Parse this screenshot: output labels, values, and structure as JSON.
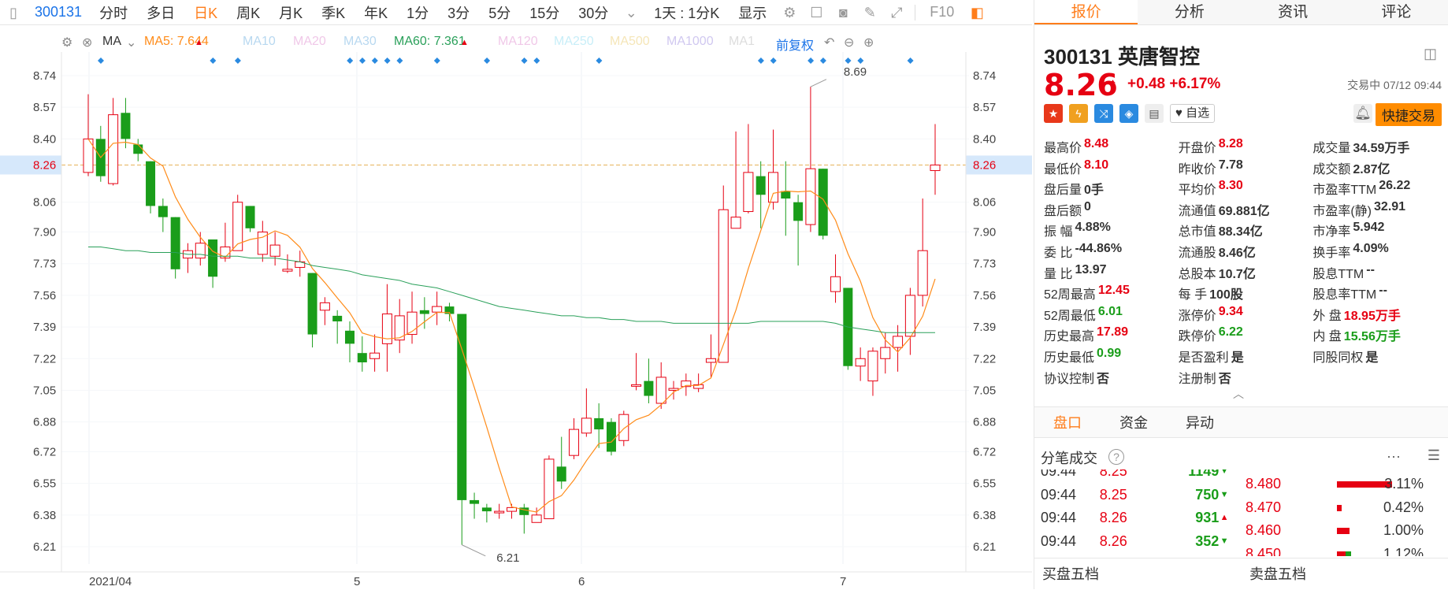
{
  "toolbar": {
    "code": "300131",
    "items": [
      "分时",
      "多日",
      "日K",
      "周K",
      "月K",
      "季K",
      "年K",
      "1分",
      "3分",
      "5分",
      "15分",
      "30分"
    ],
    "selected": "日K",
    "range": "1天 : 1分K",
    "display": "显示",
    "fq": "F10"
  },
  "ma": {
    "label": "MA",
    "ma5": "MA5: 7.644",
    "ma10": "MA10",
    "ma20": "MA20",
    "ma30": "MA30",
    "ma60": "MA60: 7.361",
    "ma120": "MA120",
    "ma250": "MA250",
    "ma500": "MA500",
    "ma1000": "MA1000",
    "ma1": "MA1",
    "fuquan": "前复权"
  },
  "chart_data": {
    "type": "candlestick",
    "yticks": [
      "8.74",
      "8.57",
      "8.40",
      "8.26",
      "8.06",
      "7.90",
      "7.73",
      "7.56",
      "7.39",
      "7.22",
      "7.05",
      "6.88",
      "6.72",
      "6.55",
      "6.38",
      "6.21"
    ],
    "xticks": [
      "2021/04",
      "5",
      "6",
      "7"
    ],
    "current": "8.26",
    "high_label": "8.69",
    "low_label": "6.21",
    "ylim": [
      6.1,
      8.85
    ],
    "candles": [
      [
        8.22,
        8.4,
        8.64,
        8.2
      ],
      [
        8.4,
        8.2,
        8.47,
        8.17
      ],
      [
        8.16,
        8.53,
        8.62,
        8.15
      ],
      [
        8.54,
        8.4,
        8.62,
        8.35
      ],
      [
        8.37,
        8.32,
        8.4,
        8.28
      ],
      [
        8.28,
        8.04,
        8.28,
        8.0
      ],
      [
        8.04,
        7.98,
        8.08,
        7.9
      ],
      [
        7.98,
        7.7,
        7.98,
        7.65
      ],
      [
        7.76,
        7.8,
        7.84,
        7.68
      ],
      [
        7.76,
        7.84,
        7.9,
        7.72
      ],
      [
        7.86,
        7.66,
        7.86,
        7.6
      ],
      [
        7.76,
        7.82,
        7.95,
        7.74
      ],
      [
        7.8,
        8.06,
        8.1,
        7.8
      ],
      [
        8.04,
        7.92,
        8.04,
        7.9
      ],
      [
        7.78,
        7.9,
        7.96,
        7.74
      ],
      [
        7.77,
        7.83,
        7.9,
        7.72
      ],
      [
        7.69,
        7.7,
        7.78,
        7.68
      ],
      [
        7.71,
        7.74,
        7.8,
        7.66
      ],
      [
        7.68,
        7.35,
        7.68,
        7.28
      ],
      [
        7.48,
        7.52,
        7.55,
        7.4
      ],
      [
        7.45,
        7.42,
        7.48,
        7.3
      ],
      [
        7.37,
        7.3,
        7.42,
        7.2
      ],
      [
        7.25,
        7.2,
        7.34,
        7.15
      ],
      [
        7.22,
        7.25,
        7.35,
        7.15
      ],
      [
        7.3,
        7.46,
        7.62,
        7.15
      ],
      [
        7.32,
        7.45,
        7.54,
        7.25
      ],
      [
        7.35,
        7.47,
        7.58,
        7.3
      ],
      [
        7.48,
        7.46,
        7.55,
        7.38
      ],
      [
        7.47,
        7.5,
        7.58,
        7.4
      ],
      [
        7.5,
        7.46,
        7.52,
        7.42
      ],
      [
        7.46,
        6.46,
        7.3,
        6.22
      ],
      [
        6.46,
        6.44,
        6.5,
        6.36
      ],
      [
        6.42,
        6.4,
        6.44,
        6.34
      ],
      [
        6.4,
        6.4,
        6.44,
        6.36
      ],
      [
        6.4,
        6.42,
        6.44,
        6.36
      ],
      [
        6.42,
        6.38,
        6.44,
        6.28
      ],
      [
        6.34,
        6.38,
        6.42,
        6.34
      ],
      [
        6.36,
        6.68,
        6.7,
        6.36
      ],
      [
        6.64,
        6.56,
        6.8,
        6.52
      ],
      [
        6.7,
        6.84,
        6.9,
        6.68
      ],
      [
        6.82,
        6.9,
        7.06,
        6.8
      ],
      [
        6.9,
        6.84,
        6.98,
        6.74
      ],
      [
        6.88,
        6.72,
        6.9,
        6.7
      ],
      [
        6.78,
        6.92,
        6.94,
        6.75
      ],
      [
        7.08,
        7.08,
        7.25,
        7.05
      ],
      [
        7.1,
        7.02,
        7.22,
        6.98
      ],
      [
        6.98,
        7.12,
        7.2,
        6.95
      ],
      [
        7.05,
        7.06,
        7.1,
        7.0
      ],
      [
        7.07,
        7.1,
        7.14,
        7.02
      ],
      [
        7.06,
        7.08,
        7.14,
        7.04
      ],
      [
        7.2,
        7.22,
        7.35,
        7.12
      ],
      [
        7.2,
        8.02,
        8.15,
        7.2
      ],
      [
        7.92,
        7.98,
        8.44,
        7.92
      ],
      [
        8.01,
        8.22,
        8.48,
        8.0
      ],
      [
        8.2,
        8.1,
        8.28,
        7.92
      ],
      [
        8.06,
        8.22,
        8.45,
        8.02
      ],
      [
        8.12,
        8.08,
        8.28,
        7.88
      ],
      [
        8.06,
        7.96,
        8.1,
        7.72
      ],
      [
        7.94,
        8.24,
        8.68,
        7.9
      ],
      [
        8.24,
        7.88,
        8.24,
        7.86
      ],
      [
        7.58,
        7.66,
        7.78,
        7.52
      ],
      [
        7.6,
        7.18,
        7.6,
        7.16
      ],
      [
        7.18,
        7.22,
        7.28,
        7.1
      ],
      [
        7.1,
        7.26,
        7.28,
        7.02
      ],
      [
        7.22,
        7.28,
        7.36,
        7.14
      ],
      [
        7.28,
        7.34,
        7.4,
        7.15
      ],
      [
        7.34,
        7.56,
        7.6,
        7.24
      ],
      [
        7.56,
        7.8,
        8.08,
        7.5
      ],
      [
        8.23,
        8.26,
        8.48,
        8.1
      ]
    ]
  },
  "right": {
    "tabs": [
      "报价",
      "分析",
      "资讯",
      "评论"
    ],
    "code": "300131",
    "name": "英唐智控",
    "price": "8.26",
    "change": "+0.48",
    "pct": "+6.17%",
    "status": "交易中 07/12 09:44",
    "zixuan": "自选",
    "quick": "快捷交易",
    "stats": [
      [
        [
          "最高价",
          "8.48",
          "red"
        ],
        [
          "开盘价",
          "8.28",
          "red"
        ],
        [
          "成交量",
          "34.59万手",
          ""
        ]
      ],
      [
        [
          "最低价",
          "8.10",
          "red"
        ],
        [
          "昨收价",
          "7.78",
          ""
        ],
        [
          "成交额",
          "2.87亿",
          ""
        ]
      ],
      [
        [
          "盘后量",
          "0手",
          ""
        ],
        [
          "平均价",
          "8.30",
          "red"
        ],
        [
          "市盈率TTM",
          "26.22",
          ""
        ]
      ],
      [
        [
          "盘后额",
          "0",
          ""
        ],
        [
          "流通值",
          "69.881亿",
          ""
        ],
        [
          "市盈率(静)",
          "32.91",
          ""
        ]
      ],
      [
        [
          "振  幅",
          "4.88%",
          ""
        ],
        [
          "总市值",
          "88.34亿",
          ""
        ],
        [
          "市净率",
          "5.942",
          ""
        ]
      ],
      [
        [
          "委  比",
          "-44.86%",
          ""
        ],
        [
          "流通股",
          "8.46亿",
          ""
        ],
        [
          "换手率",
          "4.09%",
          ""
        ]
      ],
      [
        [
          "量  比",
          "13.97",
          ""
        ],
        [
          "总股本",
          "10.7亿",
          ""
        ],
        [
          "股息TTM",
          "--",
          ""
        ]
      ],
      [
        [
          "52周最高",
          "12.45",
          "red"
        ],
        [
          "每  手",
          "100股",
          ""
        ],
        [
          "股息率TTM",
          "--",
          ""
        ]
      ],
      [
        [
          "52周最低",
          "6.01",
          "grn"
        ],
        [
          "涨停价",
          "9.34",
          "red"
        ],
        [
          "外  盘",
          "18.95万手",
          "red"
        ]
      ],
      [
        [
          "历史最高",
          "17.89",
          "red"
        ],
        [
          "跌停价",
          "6.22",
          "grn"
        ],
        [
          "内  盘",
          "15.56万手",
          "grn"
        ]
      ],
      [
        [
          "历史最低",
          "0.99",
          "grn"
        ],
        [
          "是否盈利",
          "是",
          ""
        ],
        [
          "同股同权",
          "是",
          ""
        ]
      ],
      [
        [
          "协议控制",
          "否",
          ""
        ],
        [
          "注册制",
          "否",
          ""
        ],
        [
          "",
          "",
          " "
        ]
      ]
    ],
    "subtabs": [
      "盘口",
      "资金",
      "异动"
    ],
    "fenbi": "分笔成交",
    "trades": [
      [
        "09:44",
        "8.25",
        "1149",
        "down"
      ],
      [
        "09:44",
        "8.25",
        "750",
        "down"
      ],
      [
        "09:44",
        "8.26",
        "931",
        "up"
      ],
      [
        "09:44",
        "8.26",
        "352",
        "down"
      ]
    ],
    "book": [
      [
        "8.480",
        "3.11%",
        70
      ],
      [
        "8.470",
        "0.42%",
        6
      ],
      [
        "8.460",
        "1.00%",
        16
      ],
      [
        "8.450",
        "1.12%",
        18
      ]
    ],
    "buy5": "买盘五档",
    "sell5": "卖盘五档"
  }
}
